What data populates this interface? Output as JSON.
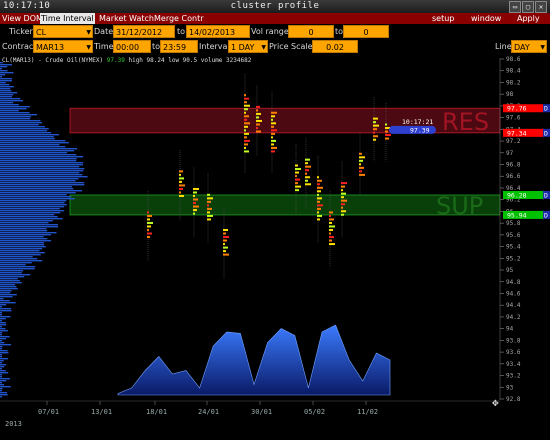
{
  "window": {
    "time": "10:17:10",
    "title": "cluster profile",
    "buttons": [
      "▭",
      "▢",
      "✕"
    ]
  },
  "menu": {
    "left": [
      "View DOM",
      "Time Interval",
      "Market Watch",
      "Merge Contr"
    ],
    "right": [
      "setup",
      "window",
      "Apply"
    ],
    "active": "Time Interval"
  },
  "toolbar": {
    "ticker_label": "Ticker",
    "ticker_value": "CL",
    "date_label": "Date",
    "date_from": "31/12/2012",
    "to_label": "to",
    "date_to": "14/02/2013",
    "vol_range_label": "Vol range",
    "vol_from": "0",
    "vol_to_label": "to",
    "vol_to": "0",
    "contract_label": "Contract",
    "contract_value": "MAR13",
    "time_label": "Time",
    "time_from": "00:00",
    "time_to_label": "to",
    "time_to": "23:59",
    "interval_label": "Interval",
    "interval_value": "1 DAY",
    "price_scale_label": "Price Scale",
    "price_scale_value": "0.02",
    "line_label": "Line",
    "line_value": "DAY"
  },
  "info": {
    "symbol": "CL(MAR13) - Crude Oil(NYMEX)",
    "last": "97.39",
    "high": "high 98.24",
    "low": "low 90.5",
    "volume": "volume 3234682"
  },
  "price_axis": {
    "labels": [
      "98.6",
      "98.4",
      "98.2",
      "98",
      "97.8",
      "97.6",
      "97.4",
      "97.2",
      "97",
      "96.8",
      "96.6",
      "96.4",
      "96.2",
      "96",
      "95.8",
      "95.6",
      "95.4",
      "95.2",
      "95",
      "94.8",
      "94.6",
      "94.4",
      "94.2",
      "94",
      "93.8",
      "93.6",
      "93.4",
      "93.2",
      "93",
      "92.8"
    ],
    "markers": [
      {
        "label": "97.76",
        "price": 97.76,
        "color": "#ff0000",
        "tag": "D"
      },
      {
        "label": "97.34",
        "price": 97.34,
        "color": "#ff0000",
        "tag": "D"
      },
      {
        "label": "96.28",
        "price": 96.28,
        "color": "#00c000",
        "tag": "D"
      },
      {
        "label": "95.94",
        "price": 95.94,
        "color": "#00c000",
        "tag": "D"
      }
    ],
    "current": {
      "time": "10:17:21",
      "price_label": "97.39",
      "price": 97.39
    }
  },
  "zones": {
    "resistance": {
      "label": "RES",
      "top": 97.76,
      "bottom": 97.34
    },
    "support": {
      "label": "SUP",
      "top": 96.28,
      "bottom": 95.94
    }
  },
  "date_axis": {
    "labels": [
      "07/01",
      "13/01",
      "18/01",
      "24/01",
      "30/01",
      "05/02",
      "11/02"
    ],
    "year": "2013"
  },
  "colors": {
    "menu_bg": "#8a0000",
    "field_bg": "#ffa500",
    "volume_fill": "#2266dd",
    "profile": "#2255cc"
  }
}
